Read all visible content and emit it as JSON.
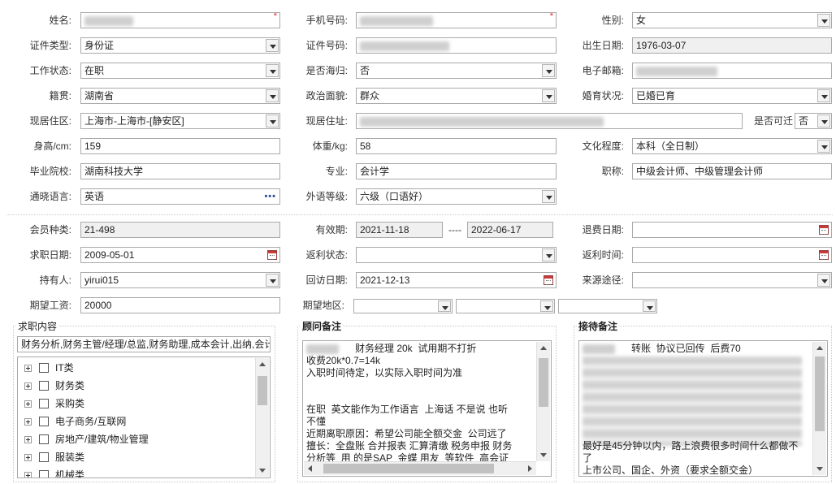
{
  "colors": {
    "required": "#e02020",
    "readonly_bg": "#f0f0f0",
    "border": "#a9a9a9"
  },
  "labels": {
    "name": "姓名:",
    "phone": "手机号码:",
    "gender": "性别:",
    "id_type": "证件类型:",
    "id_no": "证件号码:",
    "birth": "出生日期:",
    "work_status": "工作状态:",
    "overseas": "是否海归:",
    "email": "电子邮箱:",
    "native": "籍贯:",
    "political": "政治面貌:",
    "marital": "婚育状况:",
    "residence_area": "现居住区:",
    "residence_addr": "现居住址:",
    "relocate": "是否可迁",
    "height": "身高/cm:",
    "weight": "体重/kg:",
    "education": "文化程度:",
    "school": "毕业院校:",
    "major": "专业:",
    "title": "职称:",
    "language": "通晓语言:",
    "foreign_level": "外语等级:",
    "member_type": "会员种类:",
    "valid_period": "有效期:",
    "period_sep": "----",
    "refund_date": "退费日期:",
    "job_date": "求职日期:",
    "rebate_status": "返利状态:",
    "rebate_time": "返利时间:",
    "holder": "持有人:",
    "revisit_date": "回访日期:",
    "source": "来源途径:",
    "salary": "期望工资:",
    "region": "期望地区:"
  },
  "values": {
    "gender": "女",
    "id_type": "身份证",
    "birth": "1976-03-07",
    "work_status": "在职",
    "overseas": "否",
    "native": "湖南省",
    "political": "群众",
    "marital": "已婚已育",
    "residence_area": "上海市-上海市-[静安区]",
    "relocate": "否",
    "height": "159",
    "weight": "58",
    "education": "本科（全日制）",
    "school": "湖南科技大学",
    "major": "会计学",
    "title": "中级会计师、中级管理会计师",
    "language": "英语",
    "foreign_level": "六级（口语好）",
    "member_type": "21-498",
    "valid_from": "2021-11-18",
    "valid_to": "2022-06-17",
    "refund_date": "",
    "job_date": "2009-05-01",
    "rebate_status": "",
    "rebate_time": "",
    "holder": "yirui015",
    "revisit_date": "2021-12-13",
    "source": "",
    "salary": "20000"
  },
  "job_panel": {
    "title": "求职内容",
    "summary": "财务分析,财务主管/经理/总监,财务助理,成本会计,出纳,会计",
    "categories": [
      {
        "label": "IT类",
        "checked": false
      },
      {
        "label": "财务类",
        "checked": true
      },
      {
        "label": "采购类",
        "checked": false
      },
      {
        "label": "电子商务/互联网",
        "checked": false
      },
      {
        "label": "房地产/建筑/物业管理",
        "checked": false
      },
      {
        "label": "服装类",
        "checked": false
      },
      {
        "label": "机械类",
        "checked": false
      }
    ]
  },
  "consultant_panel": {
    "title": "顾问备注",
    "lines": [
      "      财务经理 20k  试用期不打折",
      "收费20k*0.7=14k",
      "入职时间待定，以实际入职时间为准",
      "",
      "",
      "在职  英文能作为工作语言  上海话 不是说 也听",
      "不懂",
      "近期离职原因：希望公司能全额交金  公司远了",
      "擅长：全盘账 合并报表 汇算清缴 税务申报 财务",
      "分析等  用 的是SAP  金蝶 用友  等软件  高会证"
    ]
  },
  "reception_panel": {
    "title": "接待备注",
    "lines": [
      "      转账  协议已回传  后费70",
      "",
      "",
      "",
      "",
      "",
      "",
      "",
      "最好是45分钟以内，路上浪费很多时间什么都做不",
      "了",
      "上市公司、国企、外资（要求全额交金）"
    ]
  },
  "icons": {
    "dropdown": "chevron-down-icon",
    "calendar": "calendar-icon",
    "more": "ellipsis-icon",
    "expand": "plus-square-icon",
    "checkbox": "checkbox-icon"
  }
}
